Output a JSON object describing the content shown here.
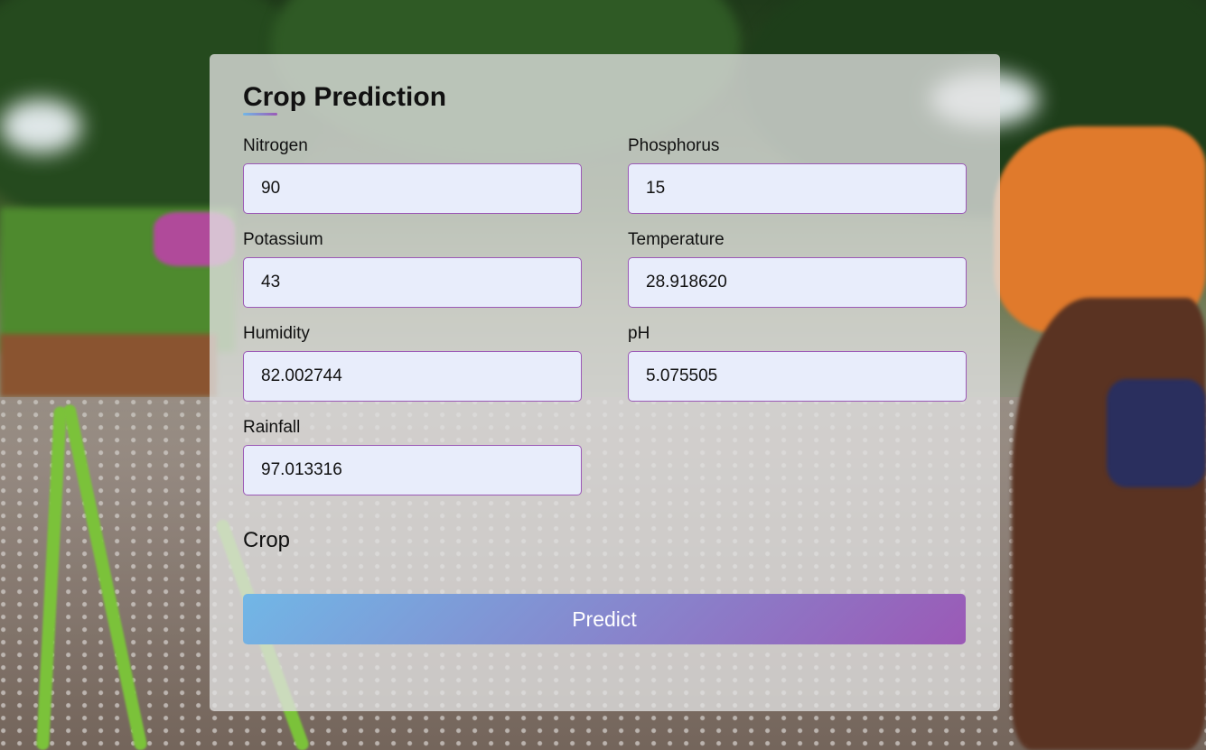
{
  "form": {
    "title": "Crop Prediction",
    "fields": {
      "nitrogen": {
        "label": "Nitrogen",
        "value": "90"
      },
      "phosphorus": {
        "label": "Phosphorus",
        "value": "15"
      },
      "potassium": {
        "label": "Potassium",
        "value": "43"
      },
      "temperature": {
        "label": "Temperature",
        "value": "28.918620"
      },
      "humidity": {
        "label": "Humidity",
        "value": "82.002744"
      },
      "ph": {
        "label": "pH",
        "value": "5.075505"
      },
      "rainfall": {
        "label": "Rainfall",
        "value": "97.013316"
      }
    },
    "result_label": "Crop",
    "submit_label": "Predict"
  },
  "colors": {
    "accent_start": "#71b7e6",
    "accent_end": "#9b59b6",
    "input_bg": "#e8edfb"
  }
}
